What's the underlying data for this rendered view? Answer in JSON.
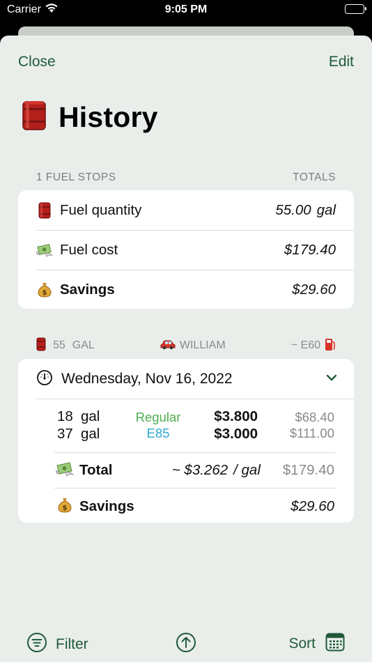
{
  "status": {
    "carrier": "Carrier",
    "time": "9:05 PM"
  },
  "nav": {
    "close": "Close",
    "edit": "Edit"
  },
  "title": "History",
  "totals": {
    "header_left": "1 FUEL STOPS",
    "header_right": "TOTALS",
    "rows": [
      {
        "icon": "oil-barrel-icon",
        "label": "Fuel quantity",
        "value": "55.00",
        "unit": "gal"
      },
      {
        "icon": "money-wings-icon",
        "label": "Fuel cost",
        "value": "$179.40"
      },
      {
        "icon": "money-bag-icon",
        "label": "Savings",
        "value": "$29.60"
      }
    ]
  },
  "summary": {
    "quantity": "55",
    "unit": "GAL",
    "vehicle": "WILLIAM",
    "ethanol": "~ E60"
  },
  "stop": {
    "date": "Wednesday, Nov 16, 2022",
    "fills": [
      {
        "qty": "18",
        "unit": "gal",
        "grade": "Regular",
        "price": "$3.800",
        "cost": "$68.40"
      },
      {
        "qty": "37",
        "unit": "gal",
        "grade": "E85",
        "price": "$3.000",
        "cost": "$111.00"
      }
    ],
    "total_label": "Total",
    "avg_price": "~ $3.262",
    "avg_unit": "/ gal",
    "total_cost": "$179.40",
    "savings_label": "Savings",
    "savings_value": "$29.60"
  },
  "toolbar": {
    "filter": "Filter",
    "sort": "Sort"
  },
  "colors": {
    "accent": "#20593a",
    "regular": "#4caf50",
    "e85": "#2eaad1",
    "sheet_bg": "#e9eeea"
  }
}
